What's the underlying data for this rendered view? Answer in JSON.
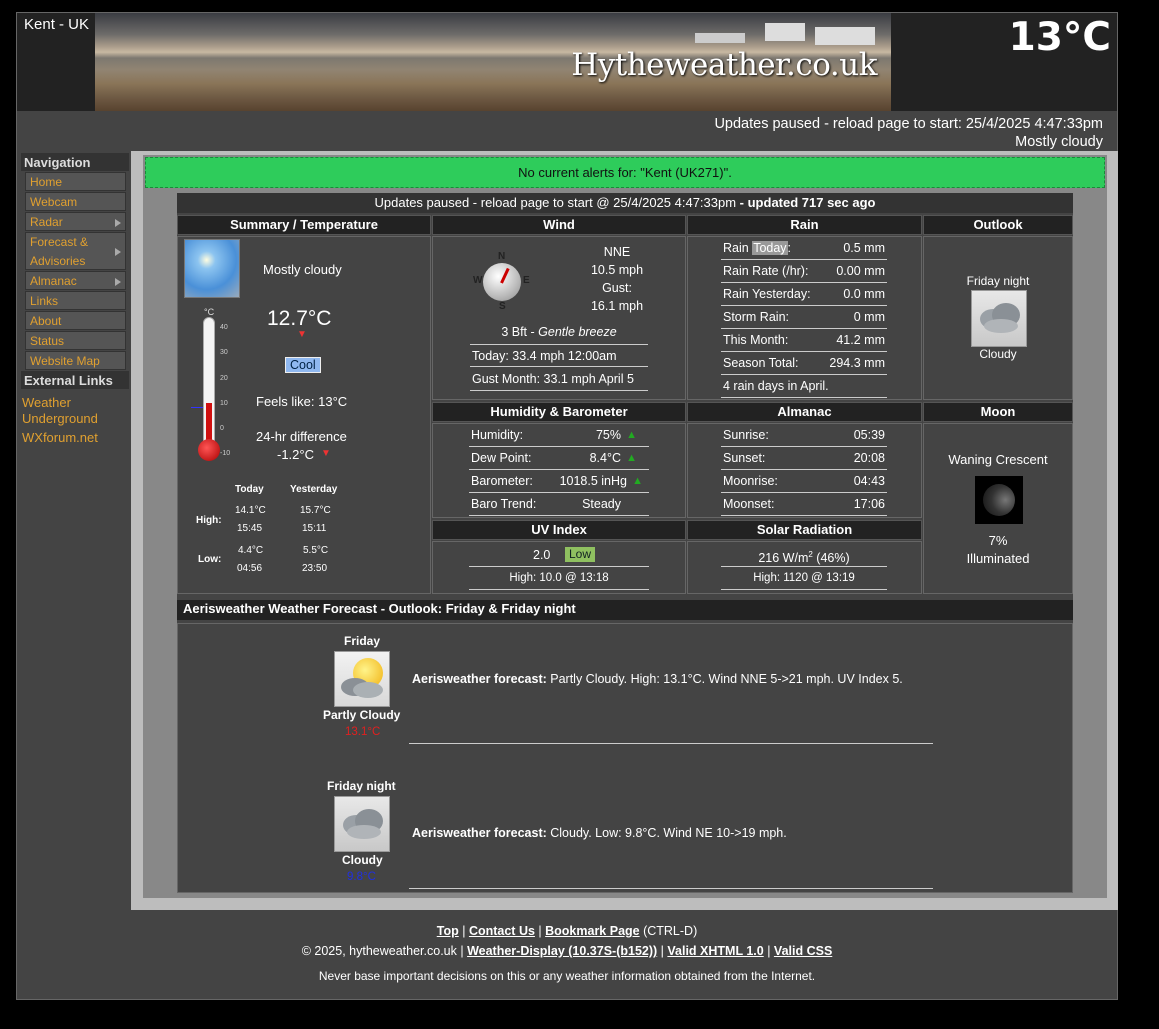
{
  "header": {
    "location": "Kent - UK",
    "site_name": "Hytheweather.co.uk",
    "current_temp": "13°C",
    "status_line": "Updates paused - reload page to start:  25/4/2025  4:47:33pm",
    "condition": "Mostly cloudy"
  },
  "nav": {
    "title": "Navigation",
    "items": [
      {
        "label": "Home"
      },
      {
        "label": "Webcam"
      },
      {
        "label": "Radar",
        "sub": true
      },
      {
        "label": "Forecast &",
        "label2": "Advisories",
        "sub": true
      },
      {
        "label": "Almanac",
        "sub": true
      },
      {
        "label": "Links"
      },
      {
        "label": "About"
      },
      {
        "label": "Status"
      },
      {
        "label": "Website Map"
      }
    ],
    "ext_title": "External Links",
    "ext_links": [
      "Weather Underground",
      "WXforum.net"
    ]
  },
  "alert": "No current alerts for: \"Kent (UK271)\".",
  "update_bar": {
    "text": "Updates paused - reload page to start @ 25/4/2025 4:47:33pm",
    "bold": " - updated 717 sec ago"
  },
  "summary": {
    "title": "Summary / Temperature",
    "condition": "Mostly cloudy",
    "temp": "12.7°C",
    "badge": "Cool",
    "feels": "Feels like: 13°C",
    "diff_label": "24-hr difference",
    "diff": "-1.2°C",
    "thermo_unit": "°C",
    "scale": [
      "40",
      "30",
      "20",
      "10",
      "0",
      "-10"
    ],
    "cols": [
      "Today",
      "Yesterday"
    ],
    "high_label": "High:",
    "low_label": "Low:",
    "high": [
      "14.1°C",
      "15.7°C"
    ],
    "high_time": [
      "15:45",
      "15:11"
    ],
    "low": [
      "4.4°C",
      "5.5°C"
    ],
    "low_time": [
      "04:56",
      "23:50"
    ]
  },
  "wind": {
    "title": "Wind",
    "dir": "NNE",
    "speed": "10.5 mph",
    "gust_label": "Gust:",
    "gust": "16.1 mph",
    "bft": "3 Bft - ",
    "bft_desc": "Gentle breeze",
    "today": "Today: 33.4 mph 12:00am",
    "month": "Gust Month: 33.1 mph April 5",
    "compass": [
      "N",
      "E",
      "S",
      "W"
    ]
  },
  "rain": {
    "title": "Rain",
    "rows": [
      {
        "k": "Rain ",
        "k2": "Today",
        "k3": ":",
        "v": "0.5 mm"
      },
      {
        "k": "Rain Rate (/hr):",
        "v": "0.00 mm"
      },
      {
        "k": "Rain Yesterday:",
        "v": "0.0 mm"
      },
      {
        "k": "Storm Rain:",
        "v": "0 mm"
      },
      {
        "k": "This Month:",
        "v": "41.2 mm"
      },
      {
        "k": "Season Total:",
        "v": "294.3 mm"
      }
    ],
    "days": "4 rain days in April."
  },
  "outlook": {
    "title": "Outlook",
    "period": "Friday night",
    "cond": "Cloudy"
  },
  "humidity": {
    "title": "Humidity & Barometer",
    "rows": [
      {
        "k": "Humidity:",
        "v": "75%"
      },
      {
        "k": "Dew Point:",
        "v": "8.4°C"
      },
      {
        "k": "Barometer:",
        "v": "1018.5 inHg"
      },
      {
        "k": "Baro Trend:",
        "v": "Steady"
      }
    ]
  },
  "almanac": {
    "title": "Almanac",
    "rows": [
      {
        "k": "Sunrise:",
        "v": "05:39"
      },
      {
        "k": "Sunset:",
        "v": "20:08"
      },
      {
        "k": "Moonrise:",
        "v": "04:43"
      },
      {
        "k": "Moonset:",
        "v": "17:06"
      }
    ]
  },
  "moon": {
    "title": "Moon",
    "phase": "Waning Crescent",
    "pct": "7%",
    "illum": "Illuminated"
  },
  "uv": {
    "title": "UV Index",
    "value": "2.0",
    "badge": "Low",
    "high": "High: 10.0 @ 13:18"
  },
  "solar": {
    "title": "Solar Radiation",
    "value": "216 W/m",
    "sup": "2",
    "pct": " (46%)",
    "high": "High: 1120 @  13:19"
  },
  "forecast": {
    "title": "Aerisweather Weather Forecast  - Outlook: Friday & Friday night",
    "items": [
      {
        "day": "Friday",
        "cond": "Partly Cloudy",
        "temp": "13.1°C",
        "label": "Aerisweather forecast:",
        "text": " Partly Cloudy. High: 13.1°C. Wind NNE 5->21 mph. UV Index 5."
      },
      {
        "day": "Friday night",
        "cond": "Cloudy",
        "temp": "9.8°C",
        "label": "Aerisweather forecast:",
        "text": " Cloudy. Low: 9.8°C. Wind NE 10->19 mph."
      }
    ]
  },
  "footer": {
    "top": "Top",
    "contact": "Contact Us",
    "bookmark": "Bookmark Page",
    "ctrl": " (CTRL-D)",
    "copy": "© 2025, hytheweather.co.uk | ",
    "wd": "Weather-Display (10.37S-(b152))",
    "xhtml": "Valid XHTML 1.0",
    "css": "Valid CSS",
    "disclaimer": "Never base important decisions on this or any weather information obtained from the Internet."
  },
  "colors": {
    "alert_bg": "#2ecc5b",
    "link": "#e0a030",
    "cool_badge": "#8fb8f0",
    "low_badge": "#8fc060",
    "high_temp": "#e02020",
    "low_temp": "#2030e0"
  }
}
